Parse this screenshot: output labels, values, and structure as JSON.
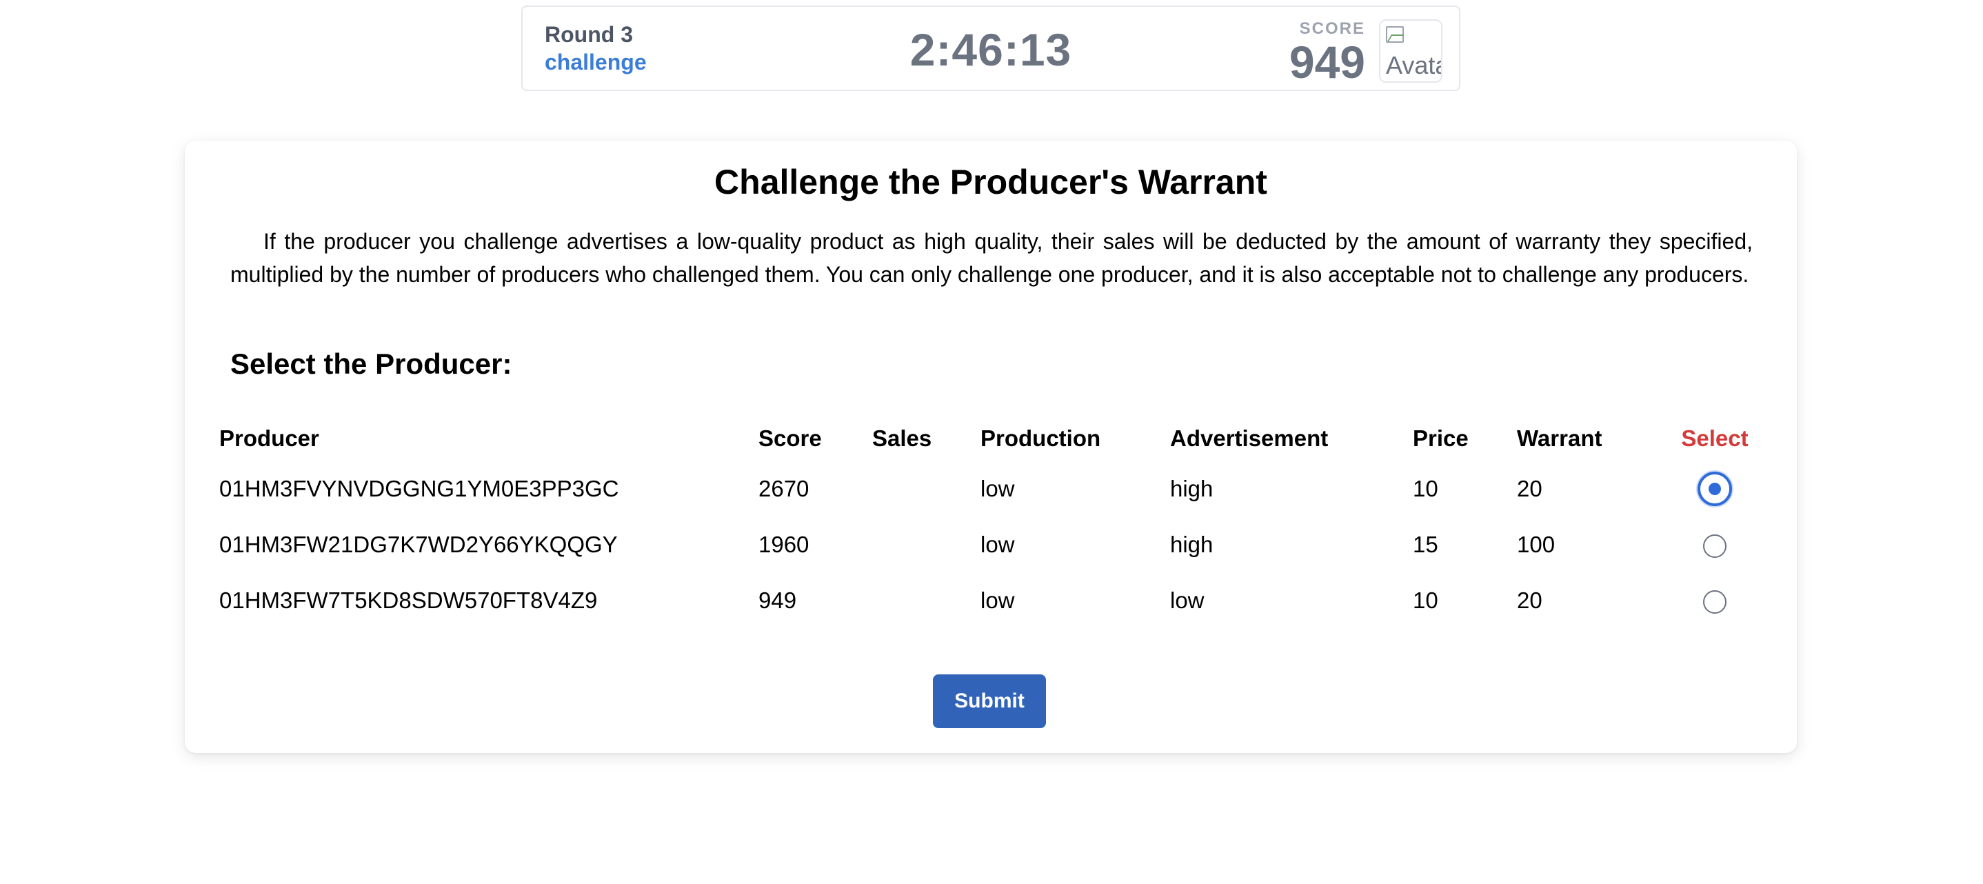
{
  "header": {
    "round_label": "Round 3",
    "phase_label": "challenge",
    "timer": "2:46:13",
    "score_caption": "SCORE",
    "score_value": "949",
    "avatar_alt": "Avatar"
  },
  "card": {
    "title": "Challenge the Producer's Warrant",
    "description": "If the producer you challenge advertises a low-quality product as high quality, their sales will be deducted by the amount of warranty they specified, multiplied by the number of producers who challenged them. You can only challenge one producer, and it is also acceptable not to challenge any producers.",
    "section_heading": "Select the Producer:",
    "table": {
      "headers": {
        "producer": "Producer",
        "score": "Score",
        "sales": "Sales",
        "production": "Production",
        "advertisement": "Advertisement",
        "price": "Price",
        "warrant": "Warrant",
        "select": "Select"
      },
      "rows": [
        {
          "producer": "01HM3FVYNVDGGNG1YM0E3PP3GC",
          "score": "2670",
          "sales": "",
          "production": "low",
          "advertisement": "high",
          "price": "10",
          "warrant": "20",
          "selected": true
        },
        {
          "producer": "01HM3FW21DG7K7WD2Y66YKQQGY",
          "score": "1960",
          "sales": "",
          "production": "low",
          "advertisement": "high",
          "price": "15",
          "warrant": "100",
          "selected": false
        },
        {
          "producer": "01HM3FW7T5KD8SDW570FT8V4Z9",
          "score": "949",
          "sales": "",
          "production": "low",
          "advertisement": "low",
          "price": "10",
          "warrant": "20",
          "selected": false
        }
      ]
    },
    "submit_label": "Submit"
  },
  "colors": {
    "accent_blue": "#3164b9",
    "phase_blue": "#3b7dd8",
    "select_header_red": "#d43a3a",
    "muted_gray": "#6b7280"
  }
}
